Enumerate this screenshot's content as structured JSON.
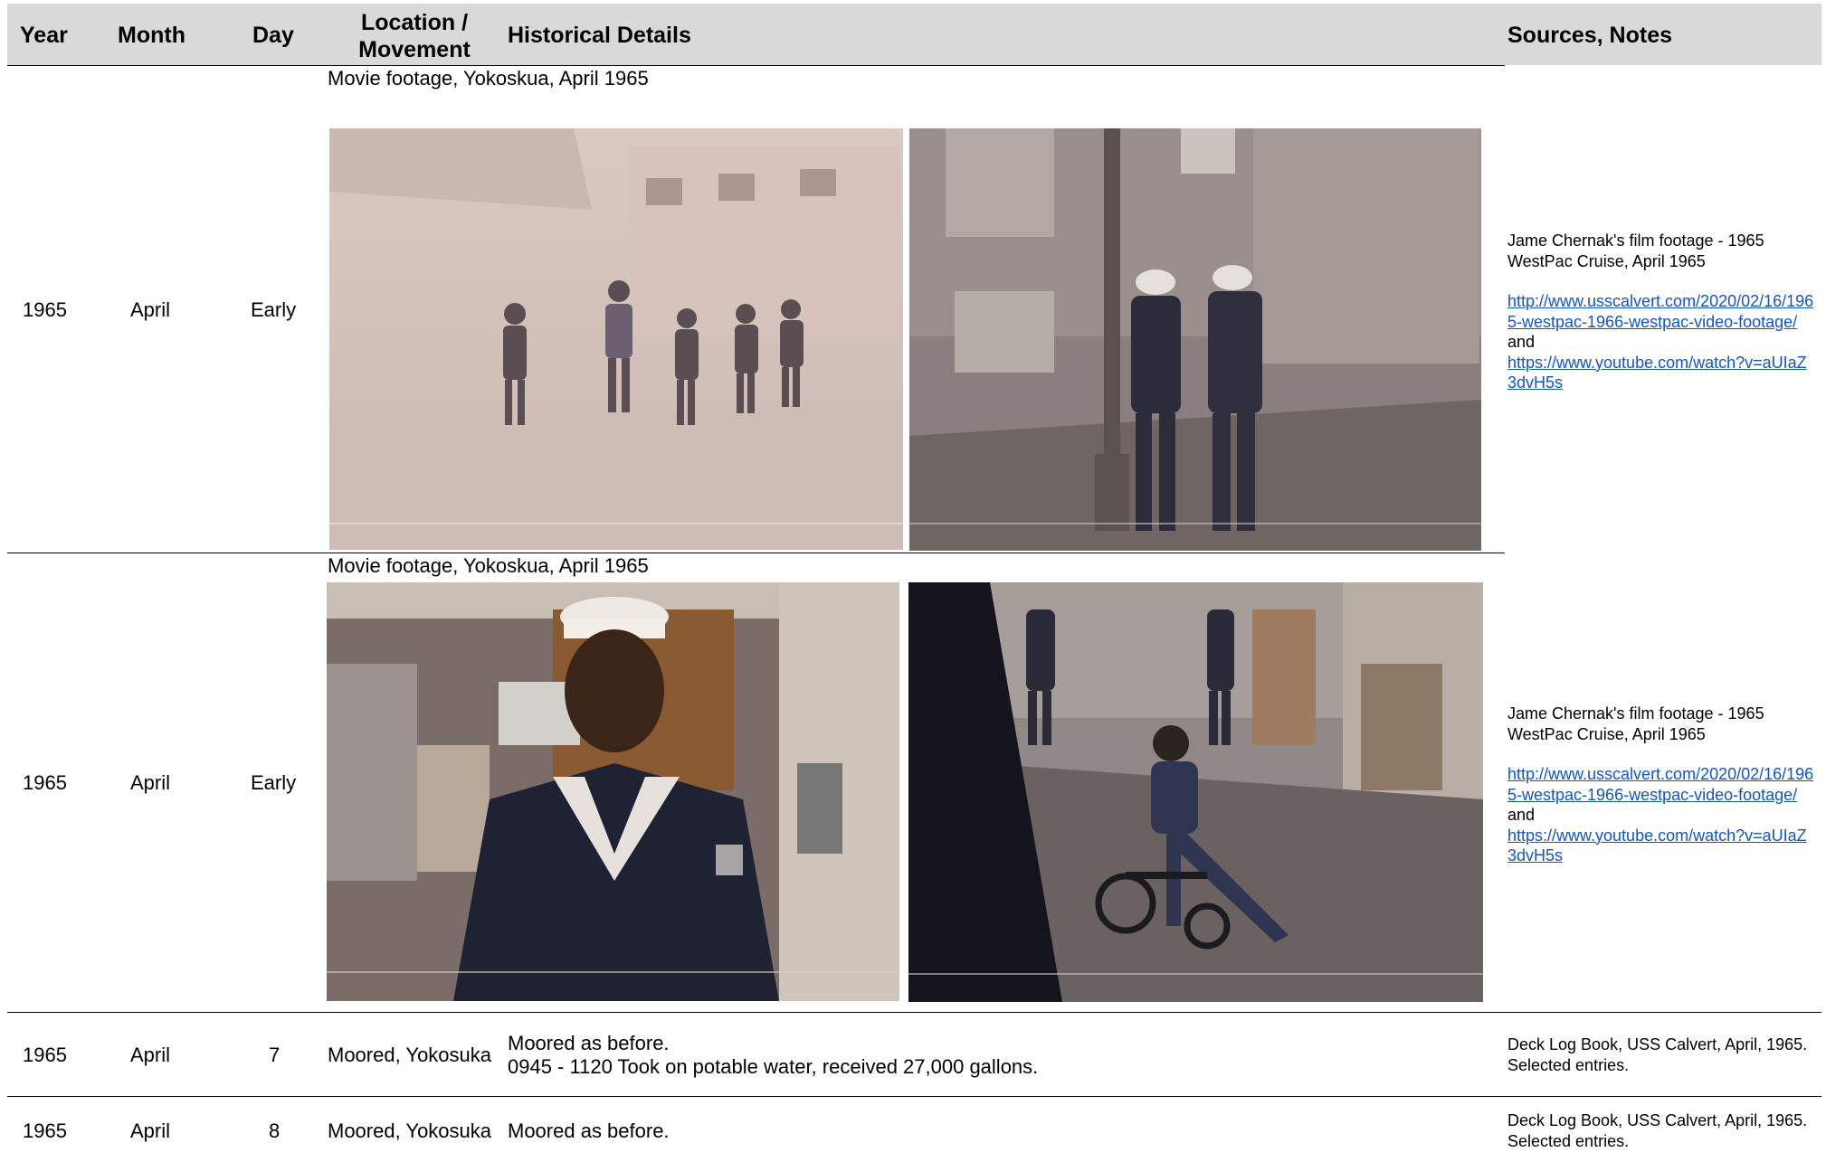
{
  "header": {
    "year": "Year",
    "month": "Month",
    "day": "Day",
    "location_line1": "Location /",
    "location_line2": "Movement",
    "details": "Historical Details",
    "sources": "Sources, Notes"
  },
  "rows": [
    {
      "year": "1965",
      "month": "April",
      "day": "Early",
      "caption": "Movie footage, Yokoskua, April 1965",
      "source_text": "Jame Chernak's film footage - 1965 WestPac Cruise, April 1965",
      "link1": "http://www.usscalvert.com/2020/02/16/1965-westpac-1966-westpac-video-footage/",
      "and": "and",
      "link2": "https://www.youtube.com/watch?v=aUIaZ3dvH5s"
    },
    {
      "year": "1965",
      "month": "April",
      "day": "Early",
      "caption": "Movie footage, Yokoskua, April 1965",
      "source_text": "Jame Chernak's film footage - 1965 WestPac Cruise, April 1965",
      "link1": "http://www.usscalvert.com/2020/02/16/1965-westpac-1966-westpac-video-footage/",
      "and": "and",
      "link2": "https://www.youtube.com/watch?v=aUIaZ3dvH5s"
    },
    {
      "year": "1965",
      "month": "April",
      "day": "7",
      "location": "Moored, Yokosuka",
      "details_line1": "Moored as before.",
      "details_line2": "0945 - 1120 Took on potable water, received 27,000 gallons.",
      "source_text": "Deck Log Book, USS Calvert, April, 1965. Selected entries."
    },
    {
      "year": "1965",
      "month": "April",
      "day": "8",
      "location": "Moored, Yokosuka",
      "details_line1": "Moored as before.",
      "source_text": "Deck Log Book, USS Calvert, April, 1965. Selected entries."
    }
  ]
}
